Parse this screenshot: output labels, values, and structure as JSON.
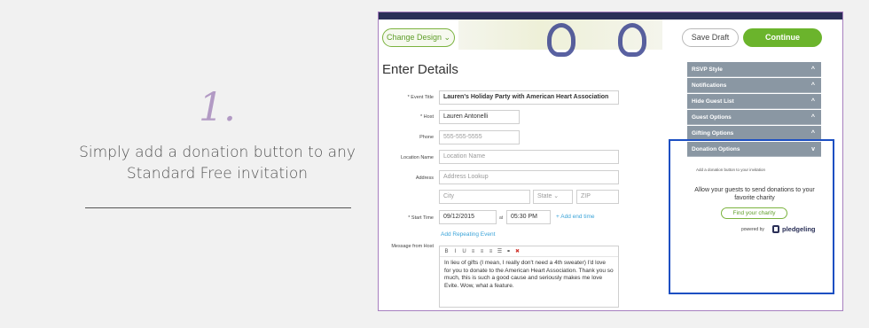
{
  "step": {
    "number": "1.",
    "caption": "Simply add a donation button to any Standard Free invitation"
  },
  "header": {
    "change_design": "Change Design",
    "save_draft": "Save Draft",
    "continue": "Continue"
  },
  "form": {
    "title": "Enter Details",
    "event_title_label": "* Event Title",
    "event_title_value": "Lauren's Holiday Party with American Heart Association",
    "host_label": "* Host",
    "host_value": "Lauren  Antonelli",
    "phone_label": "Phone",
    "phone_placeholder": "555-555-5555",
    "location_name_label": "Location Name",
    "location_name_placeholder": "Location Name",
    "address_label": "Address",
    "address_placeholder": "Address Lookup",
    "city_placeholder": "City",
    "state_placeholder": "State",
    "zip_placeholder": "ZIP",
    "start_time_label": "* Start Time",
    "start_date_value": "09/12/2015",
    "at_label": "at",
    "start_time_value": "05:30 PM",
    "add_end_time": "+ Add end time",
    "add_repeating": "Add Repeating Event",
    "message_label": "Message from Host",
    "message_value": "In lieu of gifts (I mean, I really don't need a 4th sweater) I'd love for you to donate to the American Heart Association. Thank you so much, this is such a good cause and seriously makes me love Evite. Wow, what a feature."
  },
  "editor_toolbar": [
    "B",
    "I",
    "U",
    "≡",
    "≡",
    "≡",
    "☰",
    "⚭",
    "✖"
  ],
  "sidebar": {
    "items": [
      {
        "label": "RSVP Style",
        "chevron": "^"
      },
      {
        "label": "Notifications",
        "chevron": "^"
      },
      {
        "label": "Hide Guest List",
        "chevron": "^"
      },
      {
        "label": "Guest Options",
        "chevron": "^"
      },
      {
        "label": "Gifting Options",
        "chevron": "^"
      },
      {
        "label": "Donation Options",
        "chevron": "v"
      }
    ],
    "donation": {
      "small_text": "Add a donation button to your invitation",
      "text": "Allow your guests to send donations to your favorite charity",
      "button": "Find your charity",
      "powered_by": "powered by",
      "brand": "pledgeling"
    }
  },
  "colors": {
    "accent_green": "#6bb42c",
    "sidebar_gray": "#8a97a3",
    "highlight_blue": "#1c4fc2",
    "step_purple": "#b29ac4"
  }
}
